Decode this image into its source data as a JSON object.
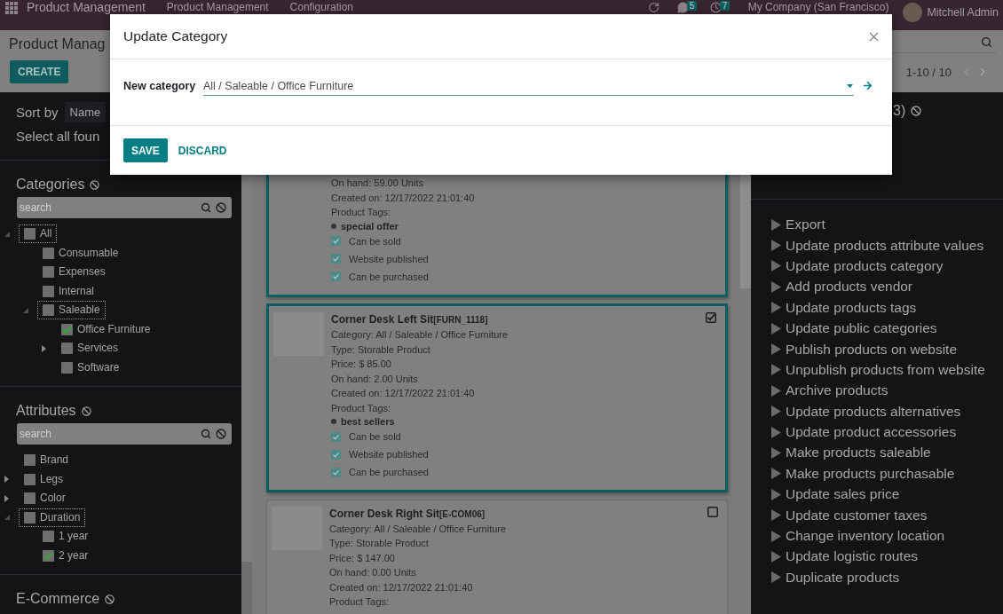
{
  "navbar": {
    "app_name": "Product Management",
    "menus": [
      "Product Management",
      "Configuration"
    ],
    "chat_count": "5",
    "activity_count": "7",
    "company": "My Company (San Francisco)",
    "user": "Mitchell Admin"
  },
  "control_panel": {
    "title": "Product Manag",
    "create_button": "CREATE",
    "pager": "1-10 / 10"
  },
  "filter_panel": {
    "sort_label": "Sort by",
    "sort_value": "Name",
    "select_all": "Select all foun",
    "sections": [
      {
        "title": "Categories",
        "search_placeholder": "search",
        "items": [
          {
            "label": "All",
            "checked": false,
            "expandable": true,
            "expanded": true,
            "children": [
              {
                "label": "Consumable",
                "checked": false,
                "expandable": false,
                "expanded": false
              },
              {
                "label": "Expenses",
                "checked": false,
                "expandable": false,
                "expanded": false
              },
              {
                "label": "Internal",
                "checked": false,
                "expandable": false,
                "expanded": false
              },
              {
                "label": "Saleable",
                "checked": false,
                "expandable": true,
                "expanded": true,
                "children": [
                  {
                    "label": "Office Furniture",
                    "checked": true,
                    "expandable": false,
                    "expanded": false
                  },
                  {
                    "label": "Services",
                    "checked": false,
                    "expandable": true,
                    "expanded": false
                  },
                  {
                    "label": "Software",
                    "checked": false,
                    "expandable": false,
                    "expanded": false
                  }
                ]
              }
            ]
          }
        ]
      },
      {
        "title": "Attributes",
        "search_placeholder": "search",
        "items": [
          {
            "label": "Brand",
            "checked": false,
            "expandable": false,
            "expanded": false
          },
          {
            "label": "Legs",
            "checked": false,
            "expandable": true,
            "expanded": false
          },
          {
            "label": "Color",
            "checked": false,
            "expandable": true,
            "expanded": false
          },
          {
            "label": "Duration",
            "checked": false,
            "expandable": true,
            "expanded": true,
            "children": [
              {
                "label": "1 year",
                "checked": false,
                "expandable": false,
                "expanded": false
              },
              {
                "label": "2 year",
                "checked": true,
                "expandable": false,
                "expanded": false
              }
            ]
          }
        ]
      },
      {
        "title": "E-Commerce"
      }
    ]
  },
  "cards": [
    {
      "selected": true,
      "lines": [
        "On hand: 59.00 Units",
        "Created on: 12/17/2022 21:01:40"
      ],
      "tags_label": "Product Tags:",
      "tags": [
        "special offer"
      ],
      "flags": [
        {
          "label": "Can be sold",
          "checked": true
        },
        {
          "label": "Website published",
          "checked": true
        },
        {
          "label": "Can be purchased",
          "checked": true
        }
      ]
    },
    {
      "selected": true,
      "title": "Corner Desk Left Sit",
      "reference": "[FURN_1118]",
      "lines": [
        "Category: All / Saleable / Office Furniture",
        "Type: Storable Product",
        "Price: $ 85.00",
        "On hand: 2.00 Units",
        "Created on: 12/17/2022 21:01:40"
      ],
      "tags_label": "Product Tags:",
      "tags": [
        "best sellers"
      ],
      "flags": [
        {
          "label": "Can be sold",
          "checked": true
        },
        {
          "label": "Website published",
          "checked": true
        },
        {
          "label": "Can be purchased",
          "checked": true
        }
      ]
    },
    {
      "selected": false,
      "title": "Corner Desk Right Sit",
      "reference": "[E-COM06]",
      "lines": [
        "Category: All / Saleable / Office Furniture",
        "Type: Storable Product",
        "Price: $ 147.00",
        "On hand: 0.00 Units",
        "Created on: 12/17/2022 21:01:40"
      ],
      "tags_label": "Product Tags:"
    }
  ],
  "actions_panel": {
    "heading": "3)",
    "actions": [
      "Export",
      "Update products attribute values",
      "Update products category",
      "Add products vendor",
      "Update products tags",
      "Update public categories",
      "Publish products on website",
      "Unpublish products from website",
      "Archive products",
      "Update products alternatives",
      "Update product accessories",
      "Make products saleable",
      "Make products purchasable",
      "Update sales price",
      "Update customer taxes",
      "Change inventory location",
      "Update logistic routes",
      "Duplicate products"
    ]
  },
  "dialog": {
    "title": "Update Category",
    "field_label": "New category",
    "field_value": "All / Saleable / Office Furniture",
    "buttons": [
      {
        "label": "SAVE",
        "kind": "primary"
      },
      {
        "label": "DISCARD",
        "kind": "link"
      }
    ]
  }
}
